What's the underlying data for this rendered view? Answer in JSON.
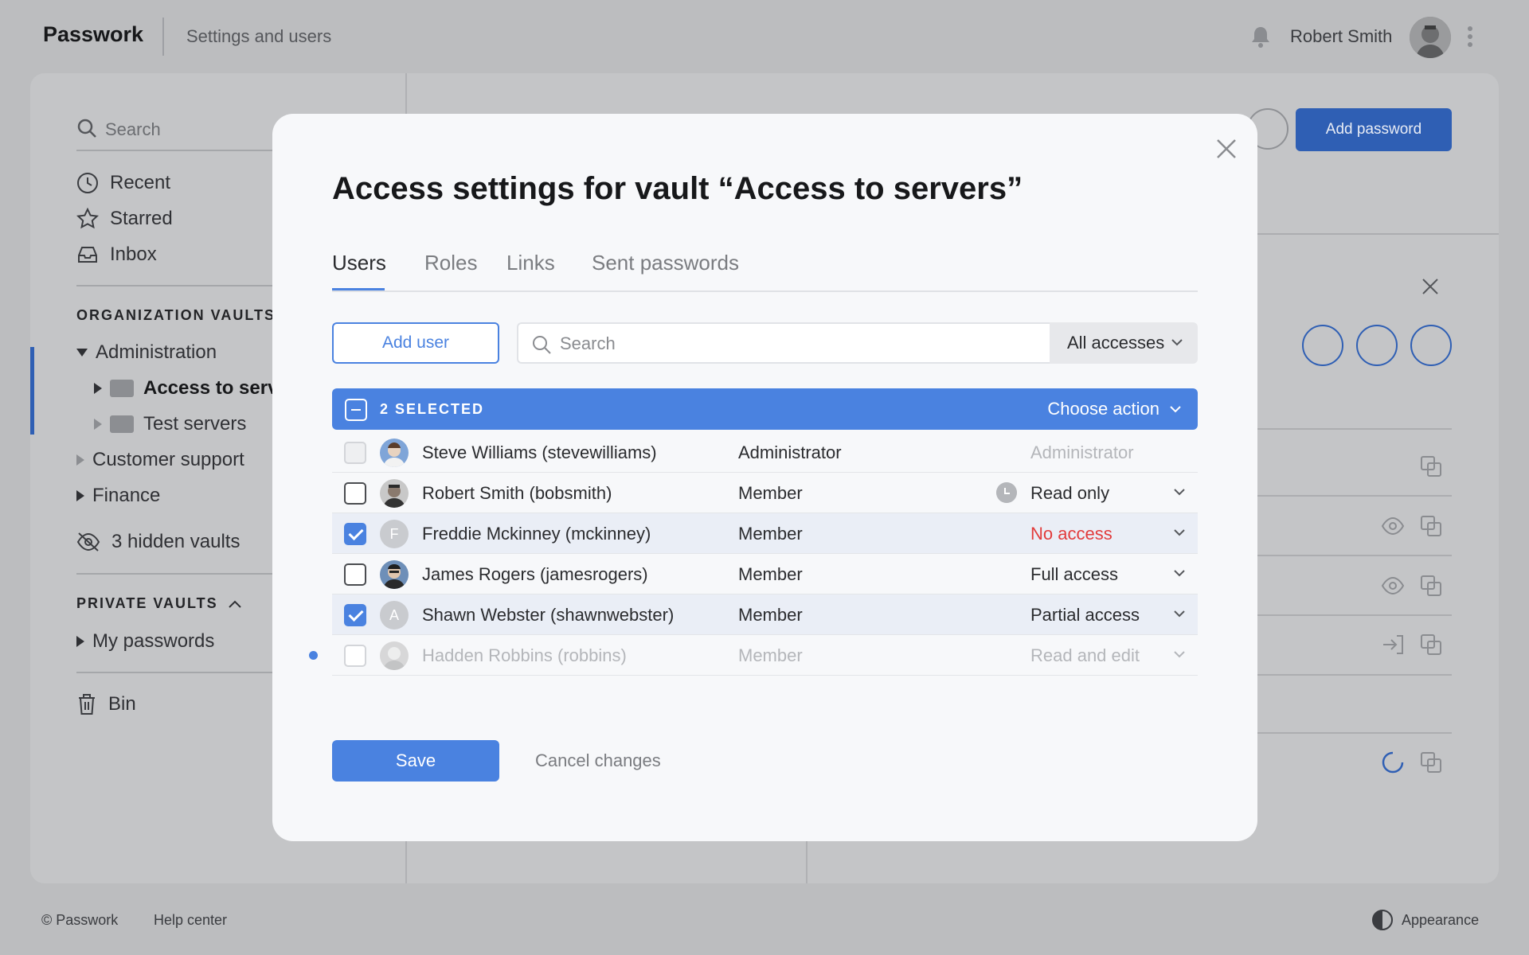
{
  "app": {
    "logo": "Passwork",
    "section": "Settings and users",
    "user_name": "Robert Smith",
    "add_password": "Add password"
  },
  "sidebar": {
    "search_placeholder": "Search",
    "nav": [
      {
        "label": "Recent",
        "icon": "clock-icon"
      },
      {
        "label": "Starred",
        "icon": "star-icon"
      },
      {
        "label": "Inbox",
        "icon": "inbox-icon"
      }
    ],
    "org_heading": "ORGANIZATION VAULTS",
    "org_vaults": {
      "administration": "Administration",
      "access_to_servers": "Access to serv",
      "test_servers": "Test servers",
      "customer_support": "Customer support",
      "finance": "Finance"
    },
    "hidden_vaults": "3 hidden vaults",
    "private_heading": "PRIVATE VAULTS",
    "my_passwords": "My passwords",
    "bin": "Bin"
  },
  "footer": {
    "copyright": "© Passwork",
    "help": "Help center",
    "appearance": "Appearance"
  },
  "modal": {
    "title": "Access settings for vault “Access to servers”",
    "tabs": [
      {
        "label": "Users",
        "active": true
      },
      {
        "label": "Roles",
        "active": false
      },
      {
        "label": "Links",
        "active": false
      },
      {
        "label": "Sent passwords",
        "active": false
      }
    ],
    "add_user": "Add user",
    "search_placeholder": "Search",
    "access_filter": "All accesses",
    "selection": {
      "count_label": "2 SELECTED",
      "action_label": "Choose action"
    },
    "users": [
      {
        "name": "Steve Williams (stevewilliams)",
        "role": "Administrator",
        "access": "Administrator",
        "checked": false,
        "state": "disabled",
        "avatar": "photo"
      },
      {
        "name": "Robert Smith (bobsmith)",
        "role": "Member",
        "access": "Read only",
        "checked": false,
        "state": "normal",
        "avatar": "photo",
        "history_icon": true
      },
      {
        "name": "Freddie Mckinney (mckinney)",
        "role": "Member",
        "access": "No access",
        "checked": true,
        "state": "normal",
        "avatar": "F",
        "access_color": "#e23b3b"
      },
      {
        "name": "James Rogers (jamesrogers)",
        "role": "Member",
        "access": "Full access",
        "checked": false,
        "state": "normal",
        "avatar": "photo"
      },
      {
        "name": "Shawn Webster (shawnwebster)",
        "role": "Member",
        "access": "Partial access",
        "checked": true,
        "state": "normal",
        "avatar": "A"
      },
      {
        "name": "Hadden Robbins (robbins)",
        "role": "Member",
        "access": "Read and edit",
        "checked": false,
        "state": "pending",
        "avatar": "photo"
      }
    ],
    "save": "Save",
    "cancel": "Cancel changes"
  },
  "colors": {
    "accent": "#4a82e0",
    "accent_dark": "#2f5fb4",
    "danger": "#e23b3b",
    "overlay": "#bcbdbf"
  }
}
